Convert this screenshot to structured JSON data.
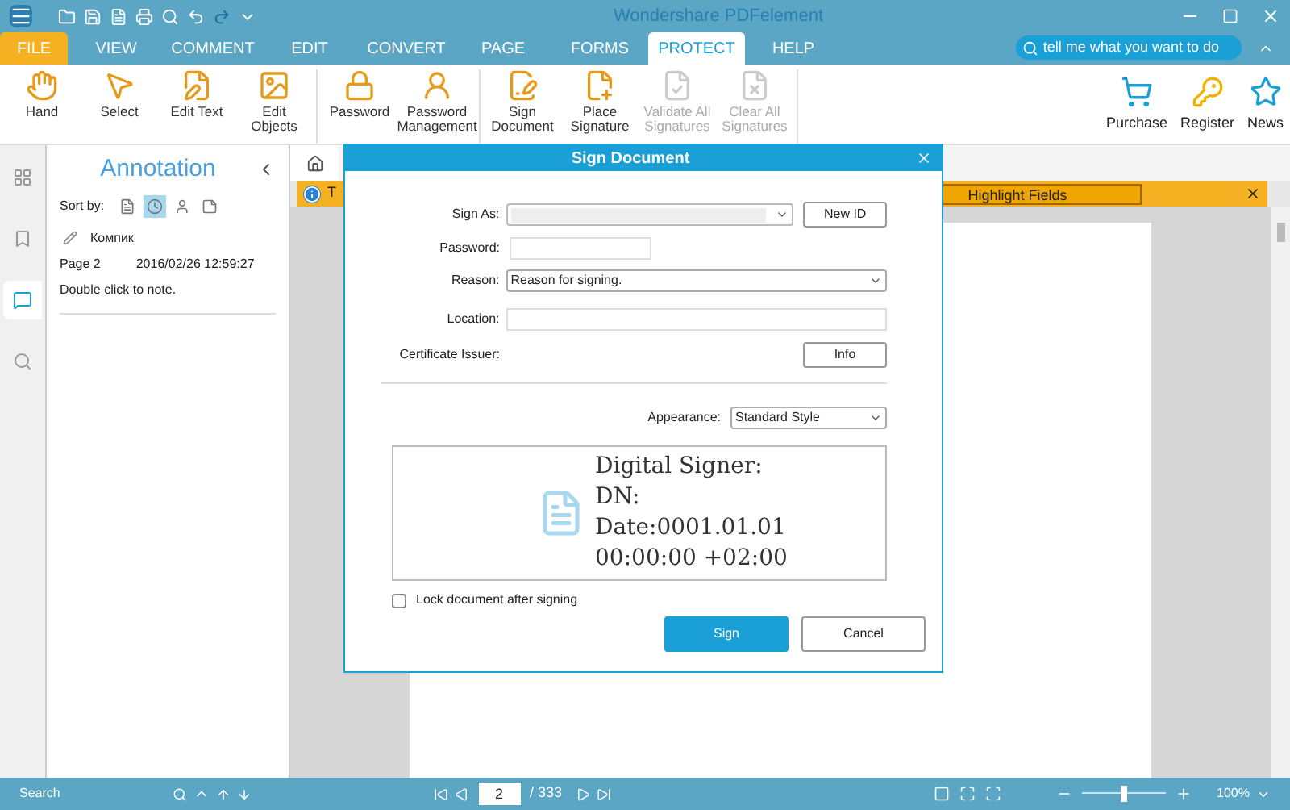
{
  "window": {
    "title": "Wondershare PDFelement"
  },
  "menu_tabs": [
    {
      "label": "FILE",
      "kind": "file",
      "selected": false
    },
    {
      "label": "VIEW",
      "kind": "tab",
      "selected": false
    },
    {
      "label": "COMMENT",
      "kind": "tab",
      "selected": false
    },
    {
      "label": "EDIT",
      "kind": "tab",
      "selected": false
    },
    {
      "label": "CONVERT",
      "kind": "tab",
      "selected": false
    },
    {
      "label": "PAGE",
      "kind": "tab",
      "selected": false
    },
    {
      "label": "FORMS",
      "kind": "tab",
      "selected": false
    },
    {
      "label": "PROTECT",
      "kind": "tab",
      "selected": true
    },
    {
      "label": "HELP",
      "kind": "tab",
      "selected": false
    }
  ],
  "search": {
    "placeholder": "tell me what you want to do"
  },
  "ribbon_groups": [
    {
      "items": [
        {
          "label": "Hand",
          "disabled": false
        },
        {
          "label": "Select",
          "disabled": false
        },
        {
          "label": "Edit Text",
          "disabled": false
        },
        {
          "label": "Edit Objects",
          "disabled": false
        }
      ]
    },
    {
      "items": [
        {
          "label": "Password",
          "disabled": false
        },
        {
          "label": "Password Management",
          "disabled": false
        }
      ]
    },
    {
      "items": [
        {
          "label": "Sign Document",
          "disabled": false
        },
        {
          "label": "Place Signature",
          "disabled": false
        },
        {
          "label": "Validate All Signatures",
          "disabled": true
        },
        {
          "label": "Clear All Signatures",
          "disabled": true
        }
      ]
    }
  ],
  "right_actions": [
    {
      "label": "Purchase"
    },
    {
      "label": "Register"
    },
    {
      "label": "News"
    }
  ],
  "left_rail": [
    {
      "selected": false
    },
    {
      "selected": false
    },
    {
      "selected": true
    },
    {
      "selected": false
    }
  ],
  "annotation_panel": {
    "title": "Annotation",
    "sort_label": "Sort by:",
    "sort_options": [
      {
        "selected": false
      },
      {
        "selected": true
      },
      {
        "selected": false
      },
      {
        "selected": false
      }
    ],
    "entry": {
      "author": "Компик",
      "page": "Page 2",
      "date": "2016/02/26 12:59:27",
      "note": "Double click to note."
    }
  },
  "notification": {
    "text": "T",
    "button": "Highlight Fields"
  },
  "dialog": {
    "title": "Sign Document",
    "sign_as": {
      "label": "Sign As:",
      "button": "New ID"
    },
    "password": {
      "label": "Password:"
    },
    "reason": {
      "label": "Reason:",
      "value": "Reason for signing."
    },
    "location": {
      "label": "Location:"
    },
    "issuer": {
      "label": "Certificate Issuer:",
      "button": "Info"
    },
    "appearance": {
      "label": "Appearance:",
      "value": "Standard Style"
    },
    "preview_lines": [
      "Digital Signer:",
      "DN:",
      "Date:0001.01.01",
      "00:00:00 +02:00"
    ],
    "lock": {
      "label": "Lock document after signing",
      "checked": false
    },
    "buttons": [
      {
        "label": "Sign",
        "kind": "primary"
      },
      {
        "label": "Cancel",
        "kind": "secondary"
      }
    ]
  },
  "status_bar": {
    "search": "Search",
    "page": "2",
    "total": "/ 333",
    "zoom": "100%",
    "zoom_slider": {
      "level": 0.5
    }
  }
}
